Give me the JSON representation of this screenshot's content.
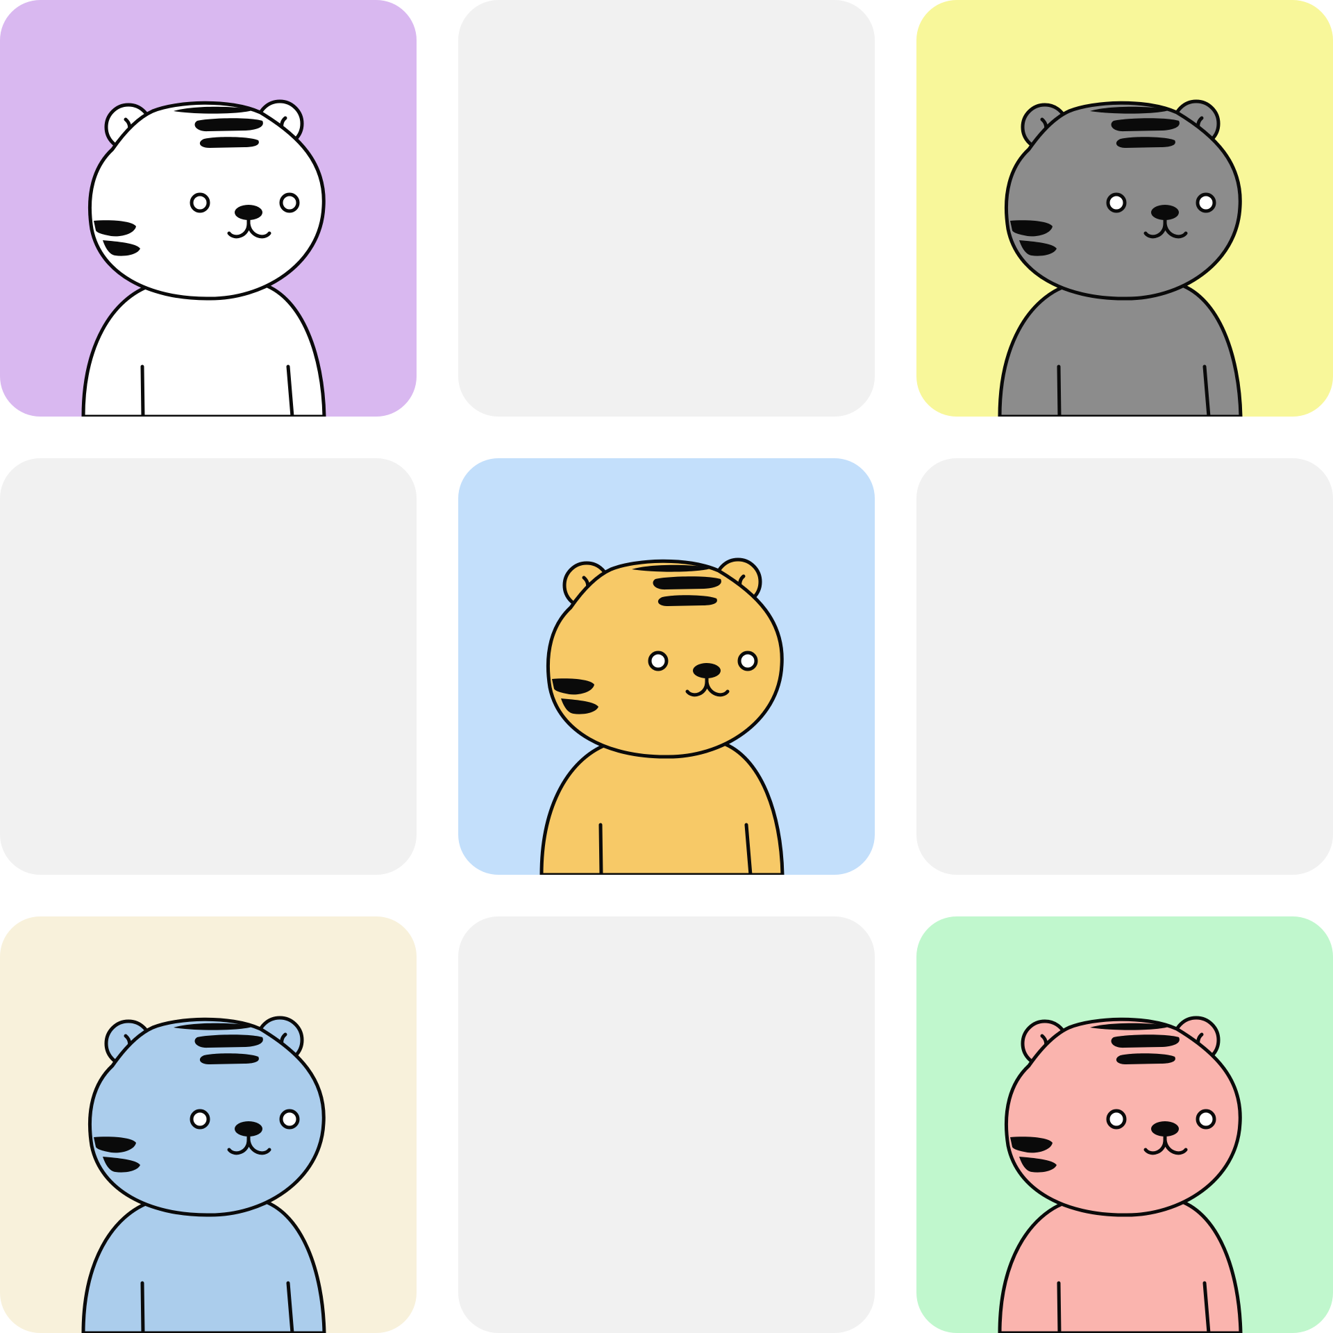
{
  "grid": {
    "columns": 3,
    "rows": 3,
    "tiles": [
      {
        "bg": "#d9b8f0",
        "tiger": "#ffffff"
      },
      {
        "bg": "#f1f1f1",
        "tiger": null
      },
      {
        "bg": "#f8f79a",
        "tiger": "#8c8c8c"
      },
      {
        "bg": "#f1f1f1",
        "tiger": null
      },
      {
        "bg": "#c3dffb",
        "tiger": "#f7c967"
      },
      {
        "bg": "#f1f1f1",
        "tiger": null
      },
      {
        "bg": "#f8f1db",
        "tiger": "#abcdec"
      },
      {
        "bg": "#f1f1f1",
        "tiger": null
      },
      {
        "bg": "#c0f7cd",
        "tiger": "#fab4ae"
      }
    ]
  },
  "colors": {
    "outline": "#0a0a0a",
    "eye_fill": "#ffffff",
    "page_bg": "#ffffff"
  },
  "icons": {
    "character": "tiger-avatar-icon",
    "empty": "empty-slot"
  }
}
